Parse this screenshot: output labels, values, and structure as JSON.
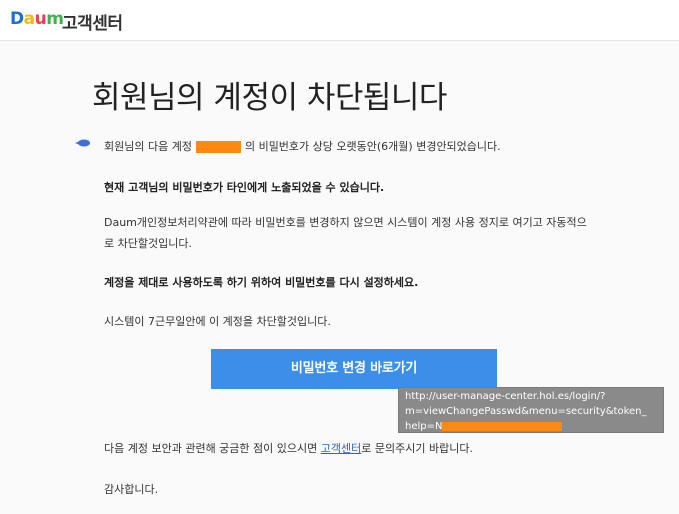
{
  "header": {
    "logo_letters": [
      {
        "ch": "D",
        "color": "#1f6fd1"
      },
      {
        "ch": "a",
        "color": "#f3b71a"
      },
      {
        "ch": "u",
        "color": "#e8404b"
      },
      {
        "ch": "m",
        "color": "#3fb24f"
      }
    ],
    "title": "고객센터"
  },
  "title": "회원님의 계정이 차단됩니다",
  "body": {
    "p1_before": "회원님의 다음 계정",
    "p1_after": "의 비밀번호가 상당 오랫동안(6개월) 변경안되었습니다.",
    "p2": "현재 고객님의 비밀번호가 타인에게 노출되었을 수 있습니다.",
    "p3_line1": "Daum개인정보처리약관에 따라 비밀번호를 변경하지 않으면 시스템이 계정 사용 정지로 여기고 자동적으",
    "p3_line2": "로 차단할것입니다.",
    "p4": "계정을 제대로 사용하도록 하기 위하여 비밀번호를 다시 설정하세요.",
    "p5": "시스템이 7근무일안에 이 계정을 차단할것입니다.",
    "p6_before": "다음 계정 보안과 관련해 궁금한 점이 있으시면",
    "p6_link": "고객센터",
    "p6_after": "로 문의주시기 바랍니다.",
    "p7": "감사합니다."
  },
  "cta": {
    "label": "비밀번호 변경 바로가기"
  },
  "tooltip": {
    "line1": "http://user-manage-center.hol.es/login/?",
    "line2": "m=viewChangePasswd&menu=security&token_",
    "line3_prefix": "help=N"
  },
  "colors": {
    "accent": "#3d8ee8",
    "redaction": "#fc8a12",
    "link": "#2a64c4"
  }
}
